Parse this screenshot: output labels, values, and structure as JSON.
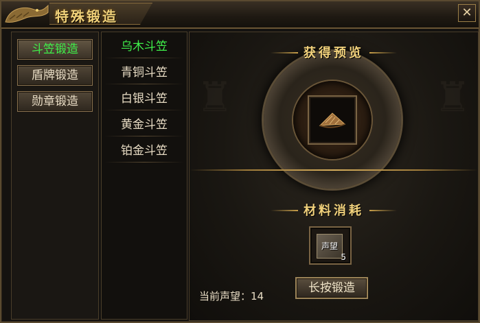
{
  "window": {
    "title": "特殊锻造",
    "close_label": "✕"
  },
  "categories": [
    {
      "label": "斗笠锻造",
      "active": true
    },
    {
      "label": "盾牌锻造",
      "active": false
    },
    {
      "label": "勋章锻造",
      "active": false
    }
  ],
  "items": [
    {
      "label": "乌木斗笠",
      "active": true
    },
    {
      "label": "青铜斗笠",
      "active": false
    },
    {
      "label": "白银斗笠",
      "active": false
    },
    {
      "label": "黄金斗笠",
      "active": false
    },
    {
      "label": "铂金斗笠",
      "active": false
    }
  ],
  "preview": {
    "section_title": "获得预览",
    "item_icon": "bamboo-hat-icon"
  },
  "materials": {
    "section_title": "材料消耗",
    "items": [
      {
        "label": "声望",
        "count": "5"
      }
    ]
  },
  "footer": {
    "reputation_label": "当前声望：14",
    "forge_button": "长按锻造"
  },
  "colors": {
    "active_text": "#3ff04a",
    "gold_text": "#f2d27c",
    "normal_text": "#e8dcc4"
  }
}
